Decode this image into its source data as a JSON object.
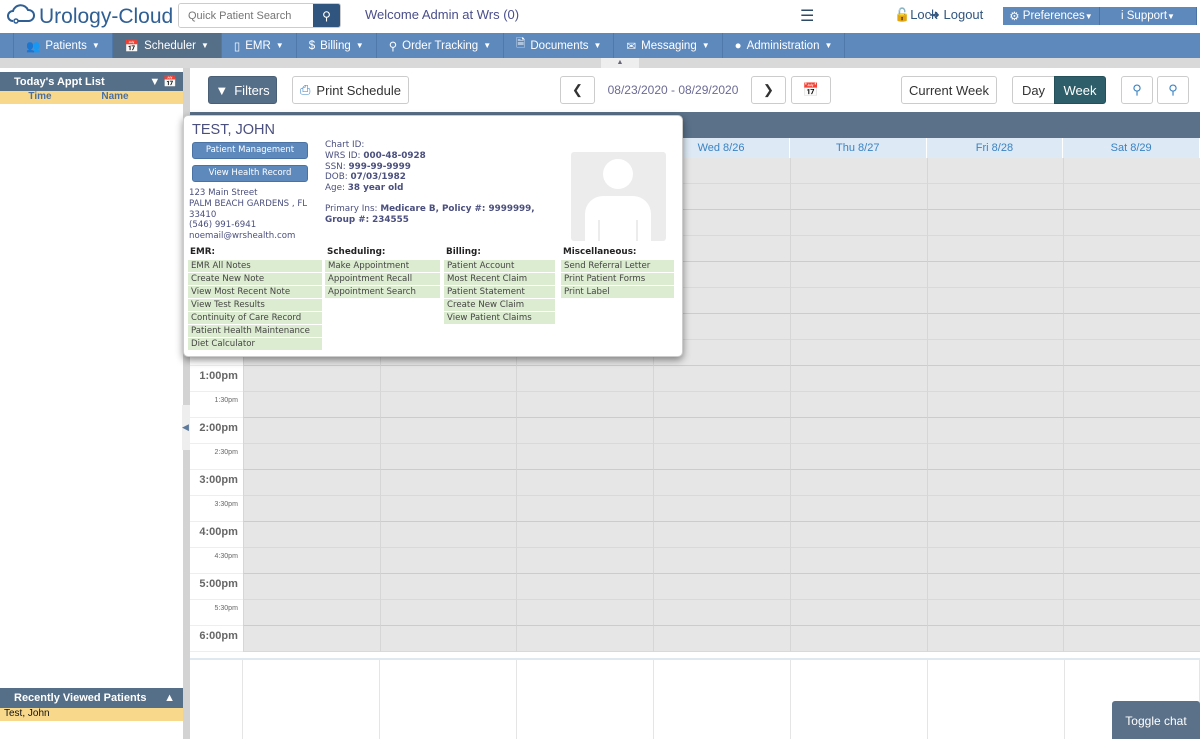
{
  "header": {
    "app_name": "Urology-Cloud",
    "search_placeholder": "Quick Patient Search",
    "welcome": "Welcome Admin at Wrs (0)",
    "lock": "Lock",
    "logout": "Logout",
    "preferences": "Preferences",
    "support": "Support"
  },
  "nav": [
    {
      "label": "Patients",
      "icon": "users-icon"
    },
    {
      "label": "Scheduler",
      "icon": "calendar-icon"
    },
    {
      "label": "EMR",
      "icon": "tablet-icon"
    },
    {
      "label": "Billing",
      "icon": "dollar-icon"
    },
    {
      "label": "Order Tracking",
      "icon": "search-icon"
    },
    {
      "label": "Documents",
      "icon": "file-icon"
    },
    {
      "label": "Messaging",
      "icon": "envelope-icon"
    },
    {
      "label": "Administration",
      "icon": "user-icon"
    }
  ],
  "sidebar": {
    "title": "Today's Appt List",
    "col_time": "Time",
    "col_name": "Name",
    "recent_title": "Recently Viewed Patients",
    "recent": [
      "Test, John"
    ]
  },
  "toolbar": {
    "filters": "Filters",
    "print": "Print Schedule",
    "date_range": "08/23/2020 - 08/29/2020",
    "current_week": "Current Week",
    "day": "Day",
    "week": "Week"
  },
  "calendar": {
    "days": [
      "Wed 8/26",
      "Thu 8/27",
      "Fri 8/28",
      "Sat 8/29"
    ],
    "times": [
      "1:00pm",
      "1:30pm",
      "2:00pm",
      "2:30pm",
      "3:00pm",
      "3:30pm",
      "4:00pm",
      "4:30pm",
      "5:00pm",
      "5:30pm",
      "6:00pm"
    ]
  },
  "popup": {
    "name": "TEST, JOHN",
    "btn_mgmt": "Patient Management",
    "btn_health": "View Health Record",
    "address": [
      "123 Main Street",
      "PALM BEACH GARDENS , FL",
      "33410",
      "(546) 991-6941",
      "noemail@wrshealth.com"
    ],
    "chart_id_label": "Chart ID:",
    "wrs_label": "WRS ID:",
    "wrs": "000-48-0928",
    "ssn_label": "SSN:",
    "ssn": "999-99-9999",
    "dob_label": "DOB:",
    "dob": "07/03/1982",
    "age_label": "Age:",
    "age": "38 year old",
    "ins_label": "Primary Ins:",
    "ins1": "Medicare B, Policy #: 9999999,",
    "ins2": "Group #: 234555",
    "sections": [
      {
        "title": "EMR:",
        "items": [
          "EMR All Notes",
          "Create New Note",
          "View Most Recent Note",
          "View Test Results",
          "Continuity of Care Record",
          "Patient Health Maintenance",
          "Diet Calculator"
        ]
      },
      {
        "title": "Scheduling:",
        "items": [
          "Make Appointment",
          "Appointment Recall",
          "Appointment Search"
        ]
      },
      {
        "title": "Billing:",
        "items": [
          "Patient Account",
          "Most Recent Claim",
          "Patient Statement",
          "Create New Claim",
          "View Patient Claims"
        ]
      },
      {
        "title": "Miscellaneous:",
        "items": [
          "Send Referral Letter",
          "Print Patient Forms",
          "Print Label"
        ]
      }
    ]
  },
  "chat": "Toggle chat"
}
